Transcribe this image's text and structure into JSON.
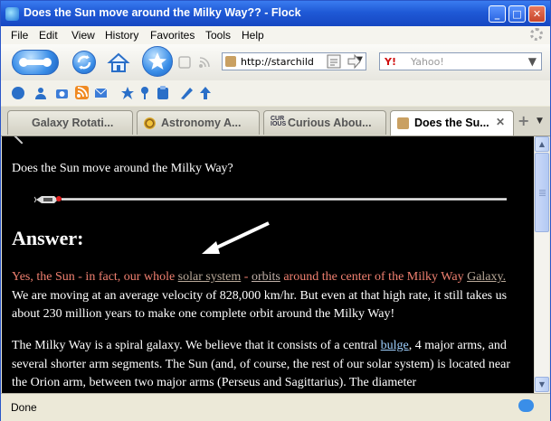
{
  "window": {
    "title": "Does the Sun move around the Milky Way?? - Flock"
  },
  "menu": [
    "File",
    "Edit",
    "View",
    "History",
    "Favorites",
    "Tools",
    "Help"
  ],
  "nav": {
    "url": "http://starchild",
    "search_placeholder": "Yahoo!"
  },
  "tabs": [
    {
      "label": "Galaxy Rotati..."
    },
    {
      "label": "Astronomy A..."
    },
    {
      "label": "Curious Abou..."
    },
    {
      "label": "Does the Su..."
    }
  ],
  "page": {
    "question": "Does the Sun move around the Milky Way?",
    "answer_heading": "Answer:",
    "p1": {
      "s1": "Yes, the Sun - in fact, our whole ",
      "link1": "solar system",
      "s2": " - ",
      "link2": "orbits",
      "s3": " around the center of the Milky Way ",
      "link3": "Galaxy.",
      "rest": " We are moving at an average velocity of 828,000 km/hr. But even at that high rate, it still takes us about 230 million years to make one complete orbit around the Milky Way!"
    },
    "p2": {
      "s1": "The Milky Way is a spiral galaxy. We believe that it consists of a central ",
      "link1": "bulge",
      "s2": ", 4 major arms, and several shorter arm segments. The Sun (and, of course, the rest of our solar system) is located near the Orion arm, between two major arms (Perseus and Sagittarius). The diameter"
    }
  },
  "status": {
    "text": "Done"
  },
  "colors": {
    "titlebar": "#1f59d6",
    "page_bg": "#000000",
    "highlight_text": "#f08070"
  }
}
